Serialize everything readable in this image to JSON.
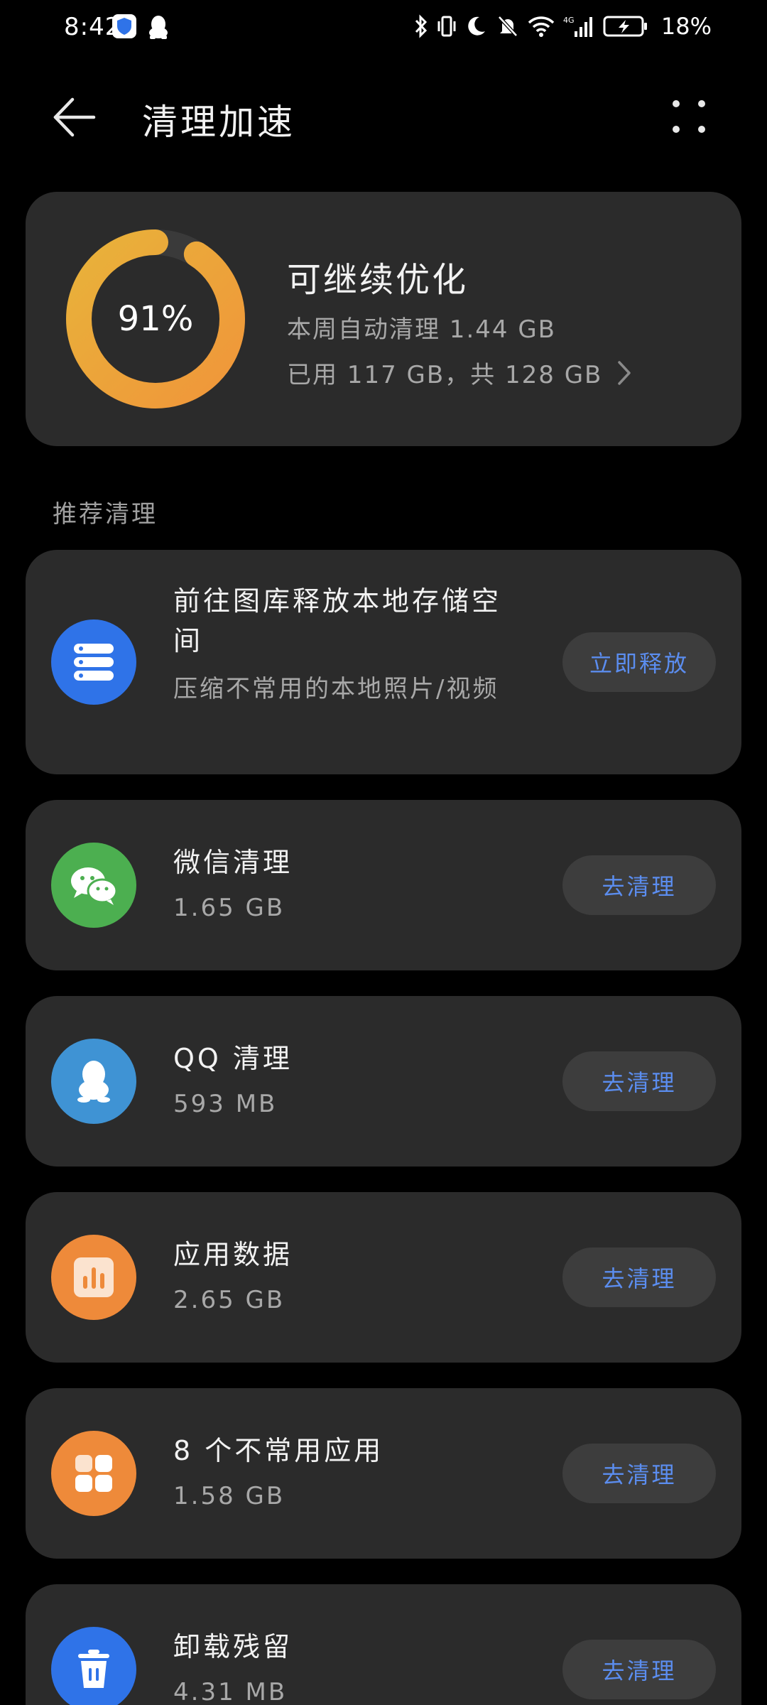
{
  "status_bar": {
    "time": "8:42",
    "battery": "18%"
  },
  "header": {
    "title": "清理加速"
  },
  "summary": {
    "percent_value": 91,
    "percent_label": "91%",
    "title": "可继续优化",
    "weekly_clean": "本周自动清理 1.44 GB",
    "storage": "已用 117 GB，共 128 GB"
  },
  "section_label": "推荐清理",
  "items": [
    {
      "title": "前往图库释放本地存储空间",
      "subtitle": "压缩不常用的本地照片/视频",
      "button": "立即释放"
    },
    {
      "title": "微信清理",
      "subtitle": "1.65 GB",
      "button": "去清理"
    },
    {
      "title": "QQ 清理",
      "subtitle": "593 MB",
      "button": "去清理"
    },
    {
      "title": "应用数据",
      "subtitle": "2.65 GB",
      "button": "去清理"
    },
    {
      "title": "8 个不常用应用",
      "subtitle": "1.58 GB",
      "button": "去清理"
    },
    {
      "title": "卸载残留",
      "subtitle": "4.31 MB",
      "button": "去清理"
    }
  ],
  "colors": {
    "background": "#000000",
    "card": "#2b2b2b",
    "button_bg": "#3d3d3d",
    "accent_blue": "#5b8def",
    "donut_start": "#f0963a",
    "donut_end": "#e8b23a",
    "gallery_icon": "#2f73e8",
    "wechat_icon": "#4caf50",
    "qq_icon": "#3f93d4",
    "app_data_icon": "#ee8a3a",
    "uninstall_icon": "#2f73e8"
  },
  "icons": {
    "back": "arrow-left-icon",
    "more": "four-dots-icon",
    "gallery": "storage-stack-icon",
    "wechat": "wechat-icon",
    "qq": "qq-penguin-icon",
    "app_data": "bar-chart-icon",
    "unused_apps": "app-grid-icon",
    "uninstall": "trash-icon"
  }
}
